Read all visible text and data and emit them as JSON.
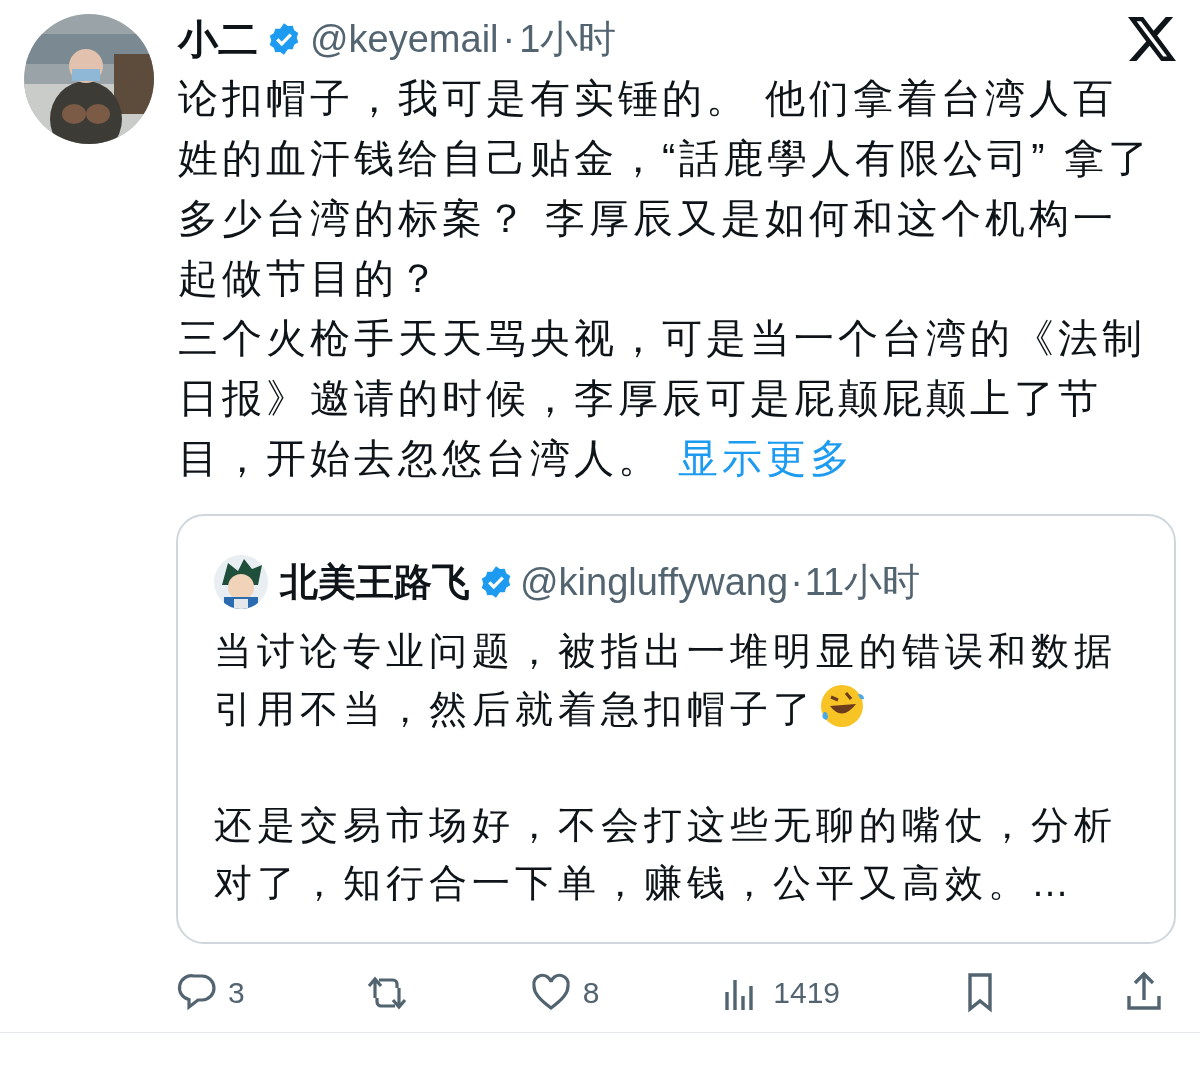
{
  "post": {
    "author": "小二",
    "verified": true,
    "handle": "@keyemail",
    "separator": "·",
    "time": "1小时",
    "paragraphs": [
      "论扣帽子，我可是有实锤的。 他们拿着台湾人百姓的血汗钱给自己贴金，“話鹿學人有限公司” 拿了多少台湾的标案？ 李厚辰又是如何和这个机构一起做节目的？",
      "三个火枪手天天骂央视，可是当一个台湾的《法制日报》邀请的时候，李厚辰可是屁颠屁颠上了节目，开始去忽悠台湾人。"
    ],
    "show_more": "显示更多"
  },
  "quote": {
    "author": "北美王路飞",
    "verified": true,
    "handle": "@kingluffywang",
    "separator": "·",
    "time": "11小时",
    "paragraphs": [
      "当讨论专业问题，被指出一堆明显的错误和数据引用不当，然后就着急扣帽子了",
      "还是交易市场好，不会打这些无聊的嘴仗，分析对了，知行合一下单，赚钱，公平又高效。…"
    ]
  },
  "actions": [
    {
      "kind": "reply",
      "count": "3"
    },
    {
      "kind": "repost"
    },
    {
      "kind": "like",
      "count": "8"
    },
    {
      "kind": "views",
      "count": "1419"
    },
    {
      "kind": "bookmark"
    },
    {
      "kind": "share"
    }
  ]
}
